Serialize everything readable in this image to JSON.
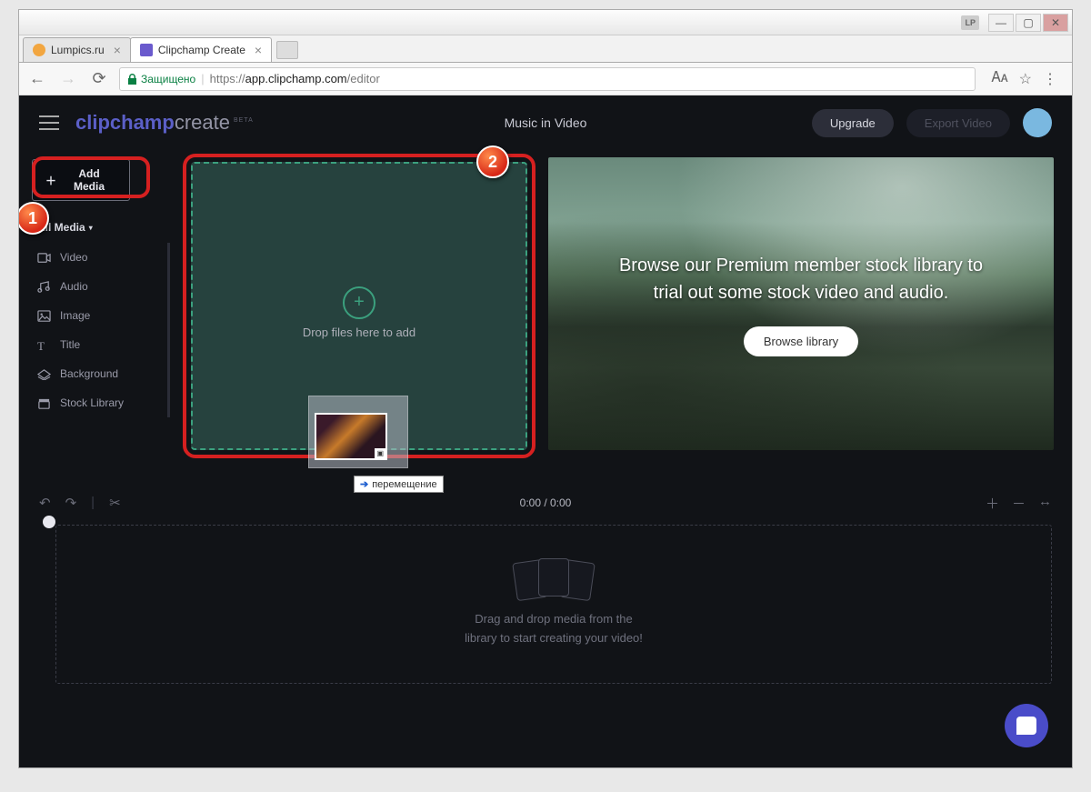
{
  "browser": {
    "lp_badge": "LP",
    "tabs": [
      {
        "title": "Lumpics.ru",
        "favicon_color": "#f2a640"
      },
      {
        "title": "Clipchamp Create",
        "favicon_color": "#6a5acd"
      }
    ],
    "secure": "Защищено",
    "url_prefix": "https://",
    "url_host": "app.clipchamp.com",
    "url_path": "/editor"
  },
  "header": {
    "logo_clip": "clipchamp",
    "logo_create": "create",
    "logo_beta": "BETA",
    "project_title": "Music in Video",
    "upgrade": "Upgrade",
    "export": "Export Video"
  },
  "sidebar": {
    "add_media": "Add Media",
    "all_media": "All Media",
    "cats": [
      "Video",
      "Audio",
      "Image",
      "Title",
      "Background",
      "Stock Library"
    ]
  },
  "dropzone": {
    "text": "Drop files here to add"
  },
  "drag": {
    "tooltip": "перемещение"
  },
  "promo": {
    "line1": "Browse our Premium member stock library to",
    "line2": "trial out some stock video and audio.",
    "browse": "Browse library"
  },
  "timeline": {
    "time": "0:00 / 0:00",
    "hint_line1": "Drag and drop media from the",
    "hint_line2": "library to start creating your video!"
  },
  "annotations": {
    "one": "1",
    "two": "2"
  }
}
